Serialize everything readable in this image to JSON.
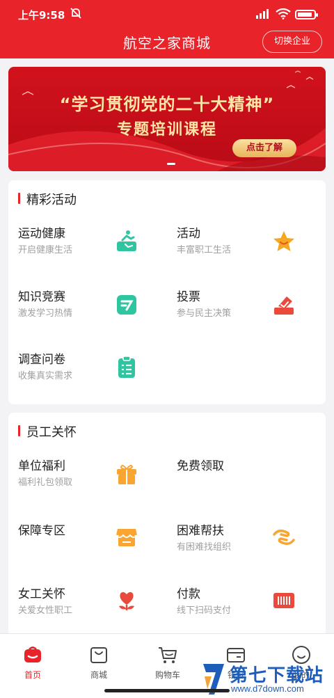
{
  "status_bar": {
    "time": "上午9:58"
  },
  "header": {
    "title": "航空之家商城",
    "switch_label": "切换企业"
  },
  "banner": {
    "line1": "“学习贯彻党的二十大精神”",
    "line2": "专题培训课程",
    "button": "点击了解"
  },
  "section_activities": {
    "title": "精彩活动",
    "items": [
      {
        "name": "运动健康",
        "sub": "开启健康生活",
        "icon": "running-icon",
        "color": "#2fc5a0"
      },
      {
        "name": "活动",
        "sub": "丰富职工生活",
        "icon": "star-icon",
        "color": "#f5a623"
      },
      {
        "name": "知识竞赛",
        "sub": "激发学习热情",
        "icon": "quiz-icon",
        "color": "#2fc5a0"
      },
      {
        "name": "投票",
        "sub": "参与民主决策",
        "icon": "vote-icon",
        "color": "#ea4a3c"
      },
      {
        "name": "调查问卷",
        "sub": "收集真实需求",
        "icon": "survey-icon",
        "color": "#2fc5a0"
      }
    ]
  },
  "section_care": {
    "title": "员工关怀",
    "items": [
      {
        "name": "单位福利",
        "sub": "福利礼包领取",
        "icon": "gift-icon",
        "color": "#f8a531"
      },
      {
        "name": "免费领取",
        "sub": "",
        "icon": "",
        "color": ""
      },
      {
        "name": "保障专区",
        "sub": "",
        "icon": "shop-icon",
        "color": "#f8a531"
      },
      {
        "name": "困难帮扶",
        "sub": "有困难找组织",
        "icon": "help-hands-icon",
        "color": "#f8a531"
      },
      {
        "name": "女工关怀",
        "sub": "关爱女性职工",
        "icon": "heart-flower-icon",
        "color": "#ea4a3c"
      },
      {
        "name": "付款",
        "sub": "线下扫码支付",
        "icon": "barcode-icon",
        "color": "#ea4a3c"
      }
    ]
  },
  "nav": {
    "tabs": [
      {
        "label": "首页",
        "icon": "home-icon",
        "active": true
      },
      {
        "label": "商城",
        "icon": "mall-bag-icon",
        "active": false
      },
      {
        "label": "购物车",
        "icon": "cart-icon",
        "active": false
      },
      {
        "label": "钱包",
        "icon": "wallet-icon",
        "active": false
      },
      {
        "label": "我的",
        "icon": "smile-icon",
        "active": false
      }
    ]
  },
  "watermark": {
    "text": "第七下载站",
    "url": "www.d7down.com"
  },
  "colors": {
    "brand": "#e8232a",
    "teal": "#2fc5a0",
    "orange": "#f8a531"
  }
}
